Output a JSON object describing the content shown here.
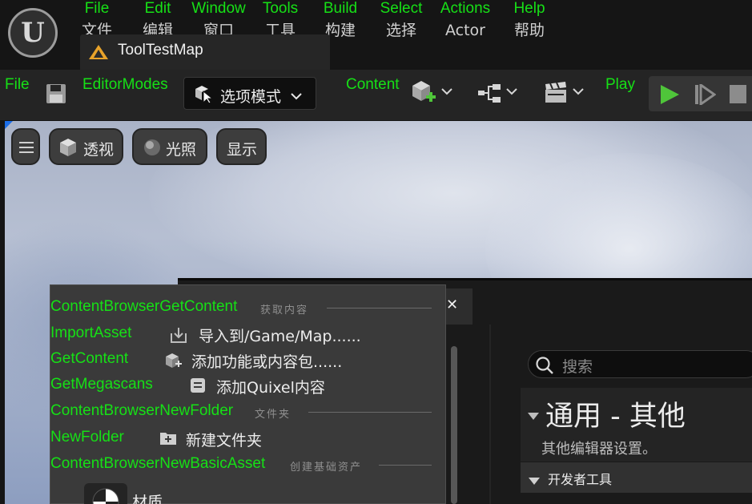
{
  "menu": [
    {
      "en": "File",
      "cn": "文件"
    },
    {
      "en": "Edit",
      "cn": "编辑"
    },
    {
      "en": "Window",
      "cn": "窗口"
    },
    {
      "en": "Tools",
      "cn": "工具"
    },
    {
      "en": "Build",
      "cn": "构建"
    },
    {
      "en": "Select",
      "cn": "选择"
    },
    {
      "en": "Actions",
      "cn": "Actor"
    },
    {
      "en": "Help",
      "cn": "帮助"
    }
  ],
  "map_tab": {
    "label": "ToolTestMap"
  },
  "toolbar": {
    "file_label": "File",
    "editor_modes_label": "EditorModes",
    "mode_select": "选项模式",
    "content_label": "Content",
    "play_label": "Play"
  },
  "viewport": {
    "perspective": "透视",
    "lighting": "光照",
    "show": "显示"
  },
  "dropdown": {
    "get_content_section": {
      "id": "ContentBrowserGetContent",
      "title": "获取内容"
    },
    "import_asset": {
      "id": "ImportAsset",
      "label": "导入到/Game/Map......"
    },
    "get_content": {
      "id": "GetContent",
      "label": "添加功能或内容包......"
    },
    "get_megascans": {
      "id": "GetMegascans",
      "label": "添加Quixel内容"
    },
    "new_folder_section": {
      "id": "ContentBrowserNewFolder",
      "title": "文件夹"
    },
    "new_folder": {
      "id": "NewFolder",
      "label": "新建文件夹"
    },
    "new_basic_asset_section": {
      "id": "ContentBrowserNewBasicAsset",
      "title": "创建基础资产"
    },
    "material": {
      "label": "材质"
    }
  },
  "settings": {
    "search_placeholder": "搜索",
    "title": "通用 - 其他",
    "subtitle": "其他编辑器设置。",
    "dev_tools": "开发者工具"
  },
  "colors": {
    "accent_green": "#16e016",
    "play_green": "#4fc53a",
    "selection_blue": "#1c6ee8"
  }
}
